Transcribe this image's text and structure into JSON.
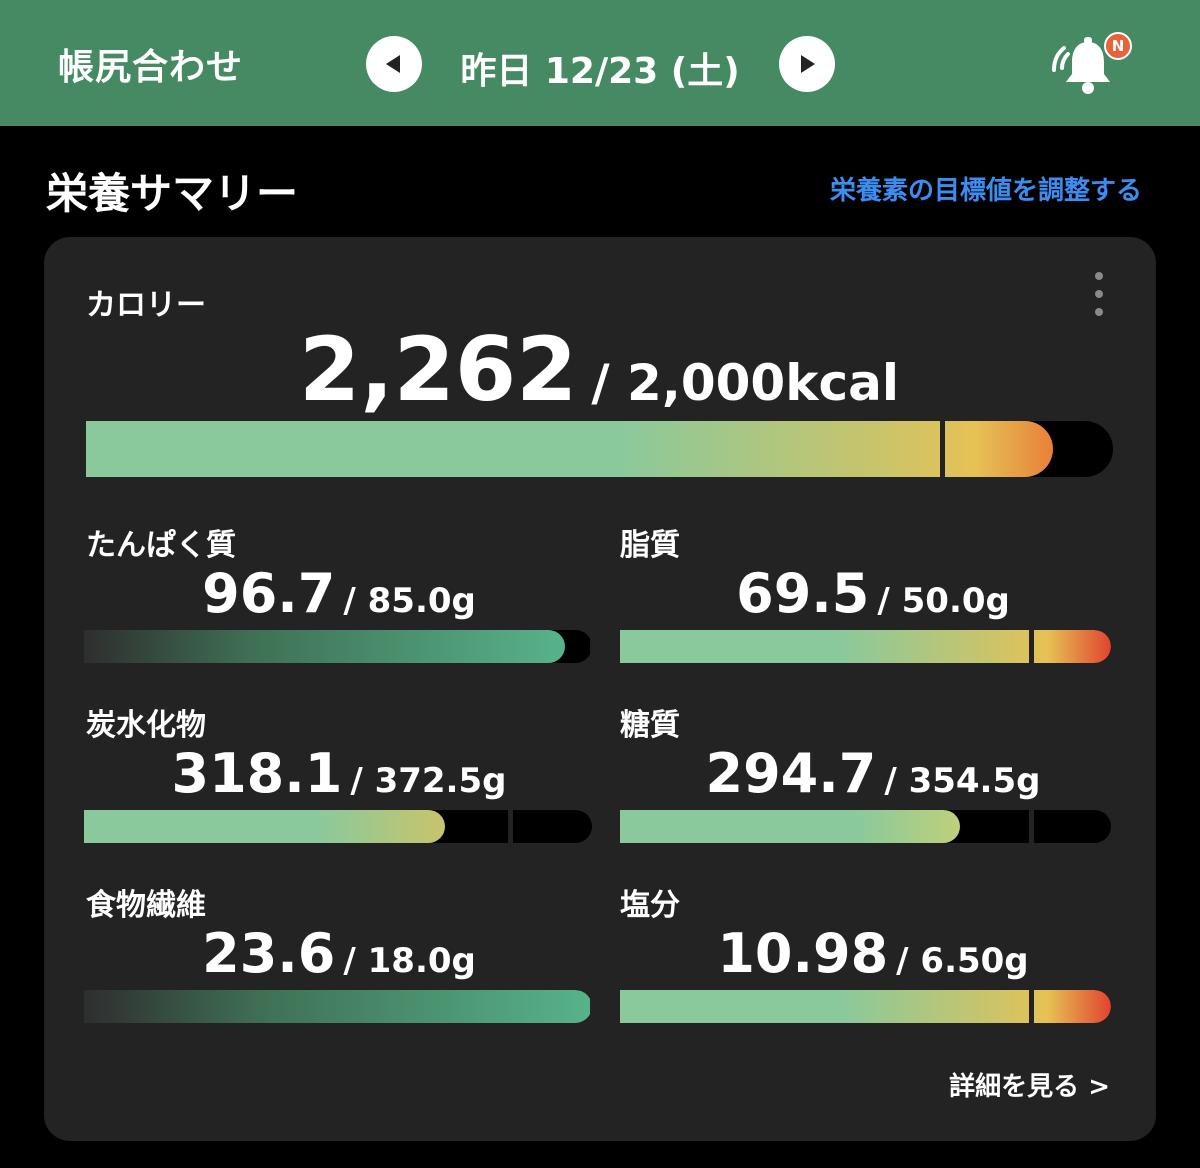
{
  "header": {
    "title": "帳尻合わせ",
    "date": "昨日 12/23 (土)",
    "badge": "N"
  },
  "summary": {
    "title": "栄養サマリー",
    "adjust_link": "栄養素の目標値を調整する",
    "details_link": "詳細を見る >"
  },
  "calorie": {
    "label": "カロリー",
    "value": "2,262",
    "target": "/ 2,000kcal",
    "fill_fraction": 0.94
  },
  "nutrients": [
    {
      "label": "たんぱく質",
      "value": "96.7",
      "target": "/ 85.0g",
      "fill_fraction": 0.95
    },
    {
      "label": "脂質",
      "value": "69.5",
      "target": "/ 50.0g",
      "fill_fraction": 1.0
    },
    {
      "label": "炭水化物",
      "value": "318.1",
      "target": "/ 372.5g",
      "fill_fraction": 0.71
    },
    {
      "label": "糖質",
      "value": "294.7",
      "target": "/ 354.5g",
      "fill_fraction": 0.69
    },
    {
      "label": "食物繊維",
      "value": "23.6",
      "target": "/ 18.0g",
      "fill_fraction": 1.0
    },
    {
      "label": "塩分",
      "value": "10.98",
      "target": "/ 6.50g",
      "fill_fraction": 1.0
    }
  ],
  "colors": {
    "header_bg": "#458a63",
    "link_blue": "#3d8cf0",
    "bar_green": "#8ac99c",
    "bar_teal": "#57b38a",
    "bar_yellow": "#e6c255",
    "bar_red": "#e0442f"
  }
}
